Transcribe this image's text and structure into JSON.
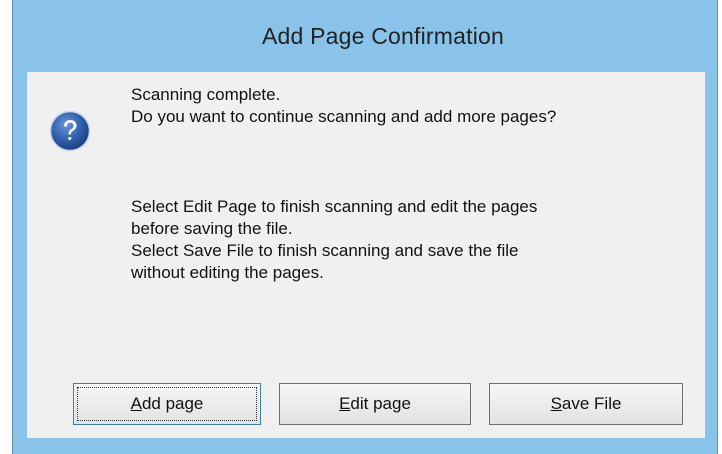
{
  "dialog": {
    "title": "Add Page Confirmation",
    "icon": "question-icon",
    "message": {
      "line1": "Scanning complete.",
      "line2": "Do you want to continue scanning and add more pages?"
    },
    "info": {
      "line1": "Select Edit Page to finish scanning and edit the pages",
      "line2": "before saving the file.",
      "line3": "Select Save File to finish scanning and save the file",
      "line4": "without editing the pages."
    },
    "buttons": {
      "add": {
        "accel": "A",
        "rest": "dd page"
      },
      "edit": {
        "accel": "E",
        "rest": "dit page"
      },
      "save": {
        "accel": "S",
        "rest": "ave File"
      }
    },
    "colors": {
      "titlebar": "#8ac3ea",
      "client": "#f0f0f0",
      "icon_blue": "#2f5fae"
    }
  }
}
